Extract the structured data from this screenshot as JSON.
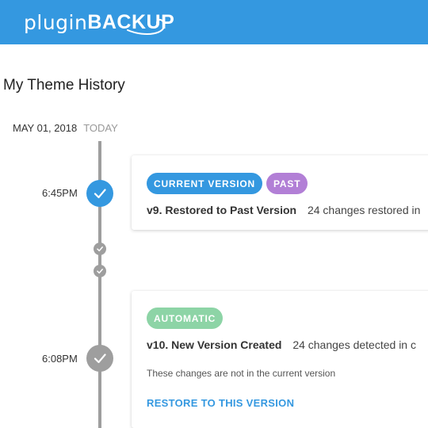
{
  "header": {
    "logo_light": "plugin",
    "logo_bold": "BACKUP",
    "brand_color": "#3498e0"
  },
  "page": {
    "title": "My Theme History"
  },
  "timeline": {
    "date": "MAY 01, 2018",
    "today_label": "TODAY",
    "entries": [
      {
        "time": "6:45PM",
        "node_icon": "check-icon",
        "node_color": "#3498e0",
        "badges": [
          {
            "label": "CURRENT VERSION",
            "color": "#3498e0"
          },
          {
            "label": "PAST",
            "color": "#b27fd6"
          }
        ],
        "title": "v9. Restored to Past Version",
        "changes": "24 changes restored in"
      },
      {
        "time": "6:08PM",
        "node_icon": "check-icon",
        "node_color": "#9e9e9e",
        "badges": [
          {
            "label": "AUTOMATIC",
            "color": "#8dd4a6"
          }
        ],
        "title": "v10. New Version Created",
        "changes": "24 changes detected in c",
        "note": "These changes are not in the current version",
        "action": "RESTORE TO THIS VERSION"
      }
    ]
  }
}
